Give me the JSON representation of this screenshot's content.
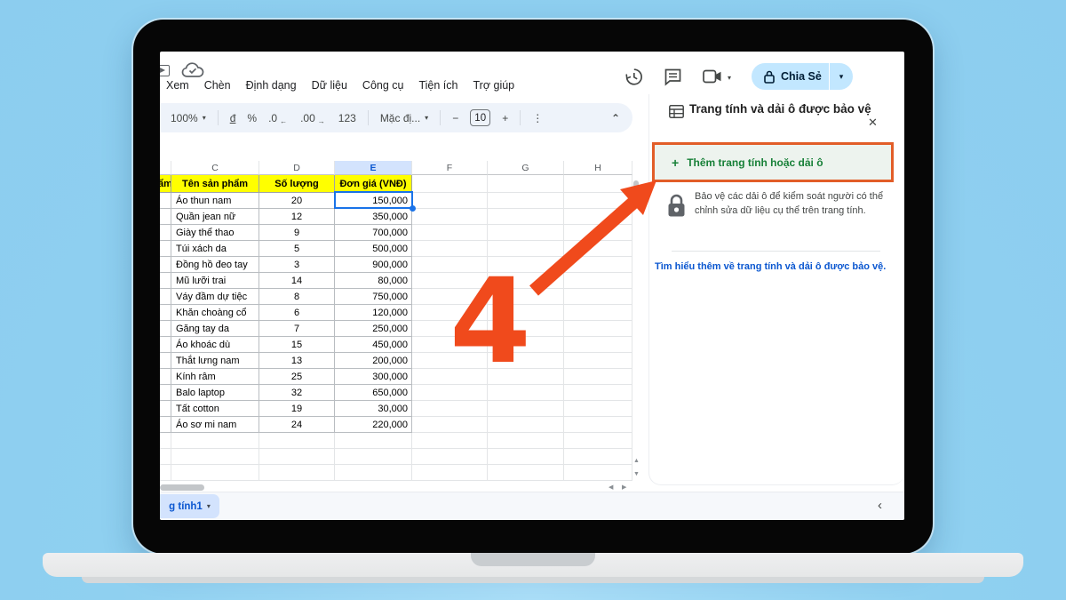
{
  "colors": {
    "annotation_orange": "#f04a1c",
    "highlight_border_orange": "#e25d28",
    "share_pill_blue": "#c2e7ff",
    "header_yellow": "#ffff00",
    "selection_blue": "#1a73e8",
    "selected_column_blue": "#d3e3fd",
    "button_green": "#188038",
    "link_blue": "#0b57d0"
  },
  "icons": {
    "caret_down": "▾",
    "more_vertical": "⋮",
    "collapse_toolbar": "⌃",
    "close": "✕",
    "chevron_left": "‹",
    "arrow_left": "←",
    "arrow_right": "→",
    "minus": "−",
    "plus": "+",
    "up_small": "▲",
    "down_small": "▼",
    "left_small": "◀",
    "right_small": "▶"
  },
  "menu_bar": {
    "items": [
      "Xem",
      "Chèn",
      "Định dạng",
      "Dữ liệu",
      "Công cụ",
      "Tiện ích",
      "Trợ giúp"
    ]
  },
  "top_right": {
    "share_label": "Chia Sẻ"
  },
  "toolbar": {
    "zoom_level": "100%",
    "currency_label": "đ",
    "percent_label": "%",
    "decrease_decimal": ".0",
    "increase_decimal": ".00",
    "number_format": "123",
    "font_name": "Mặc đị...",
    "font_size": "10"
  },
  "sheet": {
    "column_letters": [
      "",
      "C",
      "D",
      "E",
      "F",
      "G",
      "H"
    ],
    "selected_column": "E",
    "partial_header": "ẩm",
    "header_row": {
      "name": "Tên sản phẩm",
      "qty": "Số lượng",
      "price": "Đơn giá (VNĐ)"
    },
    "rows": [
      {
        "name": "Áo thun nam",
        "qty": "20",
        "price": "150,000"
      },
      {
        "name": "Quần jean nữ",
        "qty": "12",
        "price": "350,000"
      },
      {
        "name": "Giày thể thao",
        "qty": "9",
        "price": "700,000"
      },
      {
        "name": "Túi xách da",
        "qty": "5",
        "price": "500,000"
      },
      {
        "name": "Đồng hồ đeo tay",
        "qty": "3",
        "price": "900,000"
      },
      {
        "name": "Mũ lưỡi trai",
        "qty": "14",
        "price": "80,000"
      },
      {
        "name": "Váy đầm dự tiệc",
        "qty": "8",
        "price": "750,000"
      },
      {
        "name": "Khăn choàng cổ",
        "qty": "6",
        "price": "120,000"
      },
      {
        "name": "Găng tay da",
        "qty": "7",
        "price": "250,000"
      },
      {
        "name": "Áo khoác dù",
        "qty": "15",
        "price": "450,000"
      },
      {
        "name": "Thắt lưng nam",
        "qty": "13",
        "price": "200,000"
      },
      {
        "name": "Kính râm",
        "qty": "25",
        "price": "300,000"
      },
      {
        "name": "Balo laptop",
        "qty": "32",
        "price": "650,000"
      },
      {
        "name": "Tất cotton",
        "qty": "19",
        "price": "30,000"
      },
      {
        "name": "Áo sơ mi nam",
        "qty": "24",
        "price": "220,000"
      }
    ],
    "tab_label": "g tính1"
  },
  "panel": {
    "title": "Trang tính và dải ô được bảo vệ",
    "add_button_label": "Thêm trang tính hoặc dải ô",
    "description": "Bảo vệ các dải ô để kiểm soát người có thể chỉnh sửa dữ liệu cụ thể trên trang tính.",
    "learn_more_link": "Tìm hiểu thêm về trang tính và dải ô được bảo vệ."
  },
  "annotation": {
    "step_number": "4"
  }
}
